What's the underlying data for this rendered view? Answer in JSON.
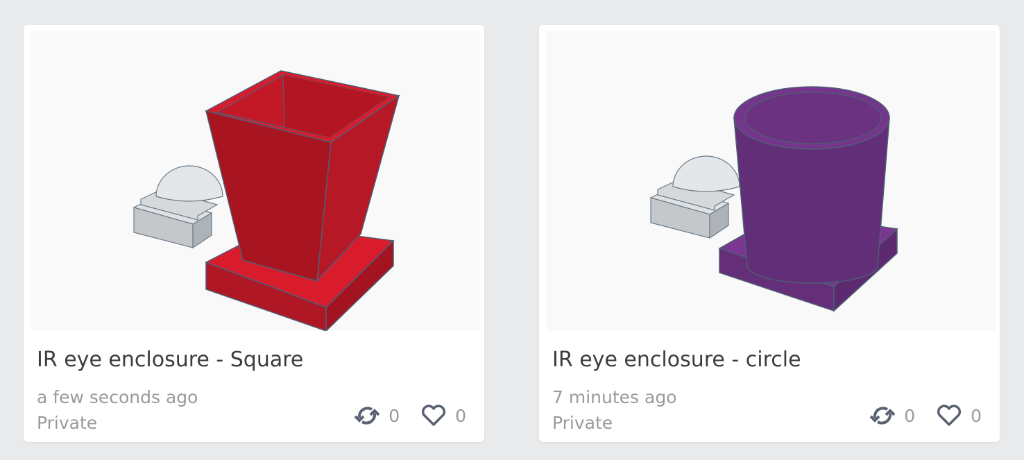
{
  "colors": {
    "background": "#e9eaec",
    "card": "#ffffff",
    "red_model": "#b01724",
    "purple_model": "#652f7a",
    "icon": "#5a6272"
  },
  "designs": [
    {
      "title": "IR eye enclosure - Square",
      "time": "a few seconds ago",
      "visibility": "Private",
      "remixes": "0",
      "likes": "0",
      "remix_icon": "remix-icon",
      "like_icon": "heart-icon"
    },
    {
      "title": "IR eye enclosure - circle",
      "time": "7 minutes ago",
      "visibility": "Private",
      "remixes": "0",
      "likes": "0",
      "remix_icon": "remix-icon",
      "like_icon": "heart-icon"
    }
  ]
}
